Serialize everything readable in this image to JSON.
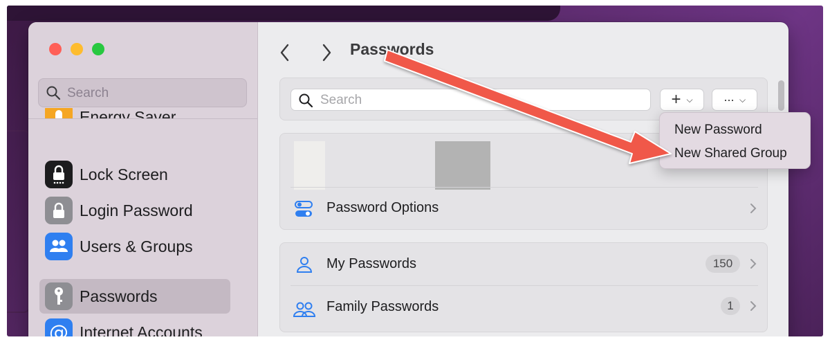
{
  "sidebar": {
    "search_placeholder": "Search",
    "items": [
      {
        "label": "Energy Saver",
        "icon": "energy-saver-icon",
        "color": "#f5a623"
      },
      {
        "label": "Lock Screen",
        "icon": "lock-screen-icon",
        "color": "#1c1c1e"
      },
      {
        "label": "Login Password",
        "icon": "login-password-icon",
        "color": "#8e8e93"
      },
      {
        "label": "Users & Groups",
        "icon": "users-groups-icon",
        "color": "#2f7ff0"
      },
      {
        "label": "Passwords",
        "icon": "key-icon",
        "color": "#8e8e93",
        "selected": true
      },
      {
        "label": "Internet Accounts",
        "icon": "at-sign-icon",
        "color": "#2f7ff0"
      }
    ]
  },
  "header": {
    "title": "Passwords"
  },
  "main": {
    "search_placeholder": "Search",
    "add_button_glyph": "+",
    "more_button_glyph": "···",
    "password_options_label": "Password Options",
    "groups": [
      {
        "label": "My Passwords",
        "count": "150",
        "icon": "person-icon"
      },
      {
        "label": "Family Passwords",
        "count": "1",
        "icon": "people-icon"
      }
    ]
  },
  "add_menu": {
    "items": [
      "New Password",
      "New Shared Group"
    ]
  },
  "colors": {
    "accent": "#2f7ff0",
    "annotation_arrow": "#f0584a"
  }
}
